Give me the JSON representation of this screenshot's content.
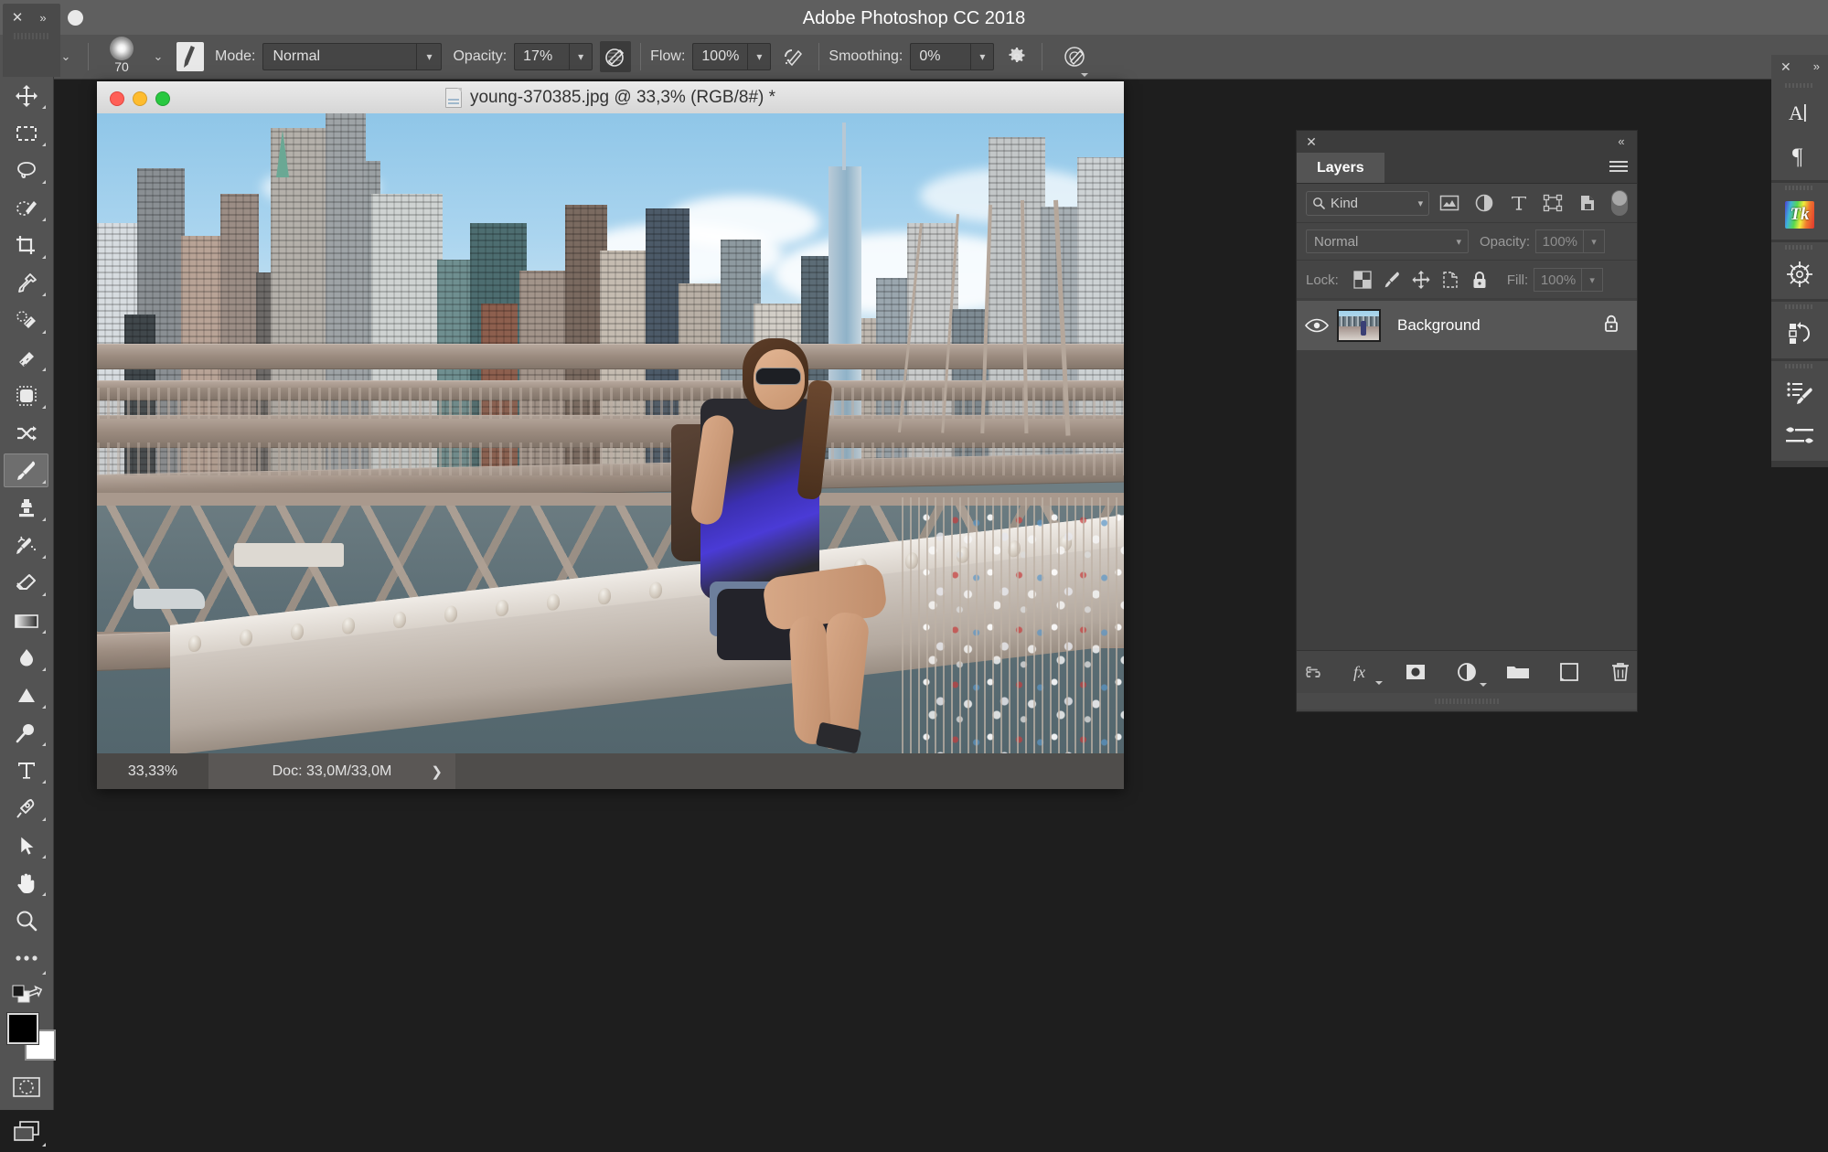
{
  "app": {
    "title": "Adobe Photoshop CC 2018"
  },
  "options_bar": {
    "tool_preset_chevron": "⌄",
    "brush_size": "70",
    "brush_preset_chevron": "⌄",
    "mode_label": "Mode:",
    "mode_value": "Normal",
    "opacity_label": "Opacity:",
    "opacity_value": "17%",
    "flow_label": "Flow:",
    "flow_value": "100%",
    "smoothing_label": "Smoothing:",
    "smoothing_value": "0%",
    "airbrush_icon": "airbrush-icon",
    "tablet_pressure_opacity_icon": "tablet-pressure-opacity-icon",
    "tablet_pressure_size_icon": "tablet-pressure-size-icon",
    "smoothing_options_icon": "gear-icon",
    "symmetry_icon": "symmetry-icon"
  },
  "toolbar": {
    "close_label": "✕",
    "expand_label": "»",
    "tools": [
      {
        "name": "move-tool",
        "selected": false
      },
      {
        "name": "rectangular-marquee-tool",
        "selected": false
      },
      {
        "name": "lasso-tool",
        "selected": false
      },
      {
        "name": "quick-selection-tool",
        "selected": false
      },
      {
        "name": "crop-tool",
        "selected": false
      },
      {
        "name": "eyedropper-tool",
        "selected": false
      },
      {
        "name": "spot-healing-brush-tool",
        "selected": false
      },
      {
        "name": "patch-tool",
        "selected": false
      },
      {
        "name": "content-aware-move-tool",
        "selected": false
      },
      {
        "name": "shuffle-tool",
        "selected": false
      },
      {
        "name": "brush-tool",
        "selected": true
      },
      {
        "name": "clone-stamp-tool",
        "selected": false
      },
      {
        "name": "history-brush-tool",
        "selected": false
      },
      {
        "name": "eraser-tool",
        "selected": false
      },
      {
        "name": "gradient-tool",
        "selected": false
      },
      {
        "name": "blur-tool",
        "selected": false
      },
      {
        "name": "dodge-tool",
        "selected": false
      },
      {
        "name": "pen-tool-alt",
        "selected": false
      },
      {
        "name": "type-tool",
        "selected": false
      },
      {
        "name": "pen-tool",
        "selected": false
      },
      {
        "name": "path-selection-tool",
        "selected": false
      },
      {
        "name": "hand-tool",
        "selected": false
      },
      {
        "name": "zoom-tool",
        "selected": false
      },
      {
        "name": "edit-toolbar-tool",
        "selected": false
      }
    ],
    "foreground_color": "#000000",
    "background_color": "#ffffff",
    "quick_mask_name": "quick-mask-icon",
    "screen_mode_name": "screen-mode-icon"
  },
  "document": {
    "filename_title": "young-370385.jpg @ 33,3% (RGB/8#) *",
    "zoom_level": "33,33%",
    "doc_info": "Doc: 33,0M/33,0M",
    "doc_info_arrow": "❯"
  },
  "layers_panel": {
    "close_label": "✕",
    "collapse_label": "«",
    "tab_label": "Layers",
    "menu_icon": "panel-menu-icon",
    "filter": {
      "kind_label": "Kind",
      "search_icon": "search-icon",
      "dropdown_icon": "⌄",
      "icons": [
        "filter-pixel-icon",
        "filter-adjustment-icon",
        "filter-type-icon",
        "filter-shape-icon",
        "filter-smart-object-icon"
      ],
      "toggle_name": "filter-enable-toggle"
    },
    "blend_mode": "Normal",
    "blend_dropdown": "⌄",
    "opacity_label": "Opacity:",
    "opacity_value": "100%",
    "opacity_dropdown": "⌄",
    "lock_label": "Lock:",
    "lock_icons": [
      "lock-transparent-pixels-icon",
      "lock-image-pixels-icon",
      "lock-position-icon",
      "lock-artboard-nesting-icon",
      "lock-all-icon"
    ],
    "fill_label": "Fill:",
    "fill_value": "100%",
    "fill_dropdown": "⌄",
    "layers": [
      {
        "name": "Background",
        "visible": true,
        "locked": true,
        "selected": true
      }
    ],
    "bottom_buttons": [
      "link-layers-icon",
      "layer-style-fx-icon",
      "layer-mask-icon",
      "new-adjustment-layer-icon",
      "new-group-icon",
      "new-layer-icon",
      "delete-layer-icon"
    ]
  },
  "right_dock": {
    "close_label": "✕",
    "expand_label": "»",
    "groups": [
      {
        "items": [
          "character-panel-icon",
          "paragraph-panel-icon"
        ]
      },
      {
        "items": [
          "color-themes-panel-icon"
        ]
      },
      {
        "items": [
          "navigator-panel-icon"
        ]
      },
      {
        "items": [
          "history-panel-icon"
        ]
      },
      {
        "items": [
          "brush-presets-panel-icon",
          "brush-settings-panel-icon"
        ]
      }
    ]
  },
  "colors": {
    "app_titlebar": "#5f5f5f",
    "options_bar": "#535353",
    "toolbar": "#535353",
    "workspace": "#1e1e1e",
    "panel": "#454545",
    "layer_row_selected": "#565656",
    "doc_titlebar": "#e3e3e3"
  }
}
